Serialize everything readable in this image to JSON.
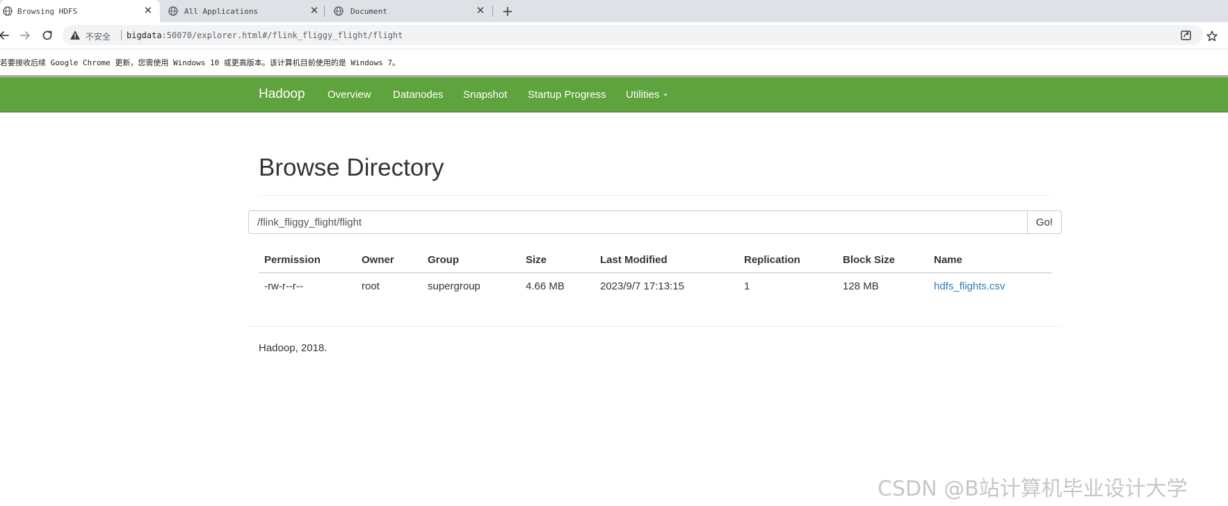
{
  "browser": {
    "tabs": [
      {
        "title": "Browsing HDFS",
        "active": true
      },
      {
        "title": "All Applications",
        "active": false
      },
      {
        "title": "Document",
        "active": false
      }
    ],
    "close_glyph": "✕",
    "new_tab_glyph": "+",
    "omnibox": {
      "insecure_label": "不安全",
      "url_host": "bigdata",
      "url_rest": ":50070/explorer.html#/flink_fliggy_flight/flight"
    },
    "infobar_message": "若要接收后续 Google Chrome 更新，您需使用 Windows 10 或更高版本。该计算机目前使用的是 Windows 7。"
  },
  "navbar": {
    "brand": "Hadoop",
    "links": [
      "Overview",
      "Datanodes",
      "Snapshot",
      "Startup Progress",
      "Utilities"
    ],
    "bg_color": "#5fa33e"
  },
  "page": {
    "title": "Browse Directory",
    "path_value": "/flink_fliggy_flight/flight",
    "go_label": "Go!"
  },
  "table": {
    "headers": [
      "Permission",
      "Owner",
      "Group",
      "Size",
      "Last Modified",
      "Replication",
      "Block Size",
      "Name"
    ],
    "rows": [
      [
        "-rw-r--r--",
        "root",
        "supergroup",
        "4.66 MB",
        "2023/9/7 17:13:15",
        "1",
        "128 MB",
        "hdfs_flights.csv"
      ]
    ],
    "link_color": "#337ab7"
  },
  "footer": {
    "text": "Hadoop, 2018."
  },
  "watermark": "CSDN @B站计算机毕业设计大学",
  "icons": {
    "tab_favicon": "globe-icon",
    "back": "back-arrow-icon",
    "forward": "forward-arrow-icon",
    "reload": "reload-icon",
    "insecure": "warning-triangle-icon",
    "share": "share-icon",
    "bookmark": "star-icon"
  }
}
